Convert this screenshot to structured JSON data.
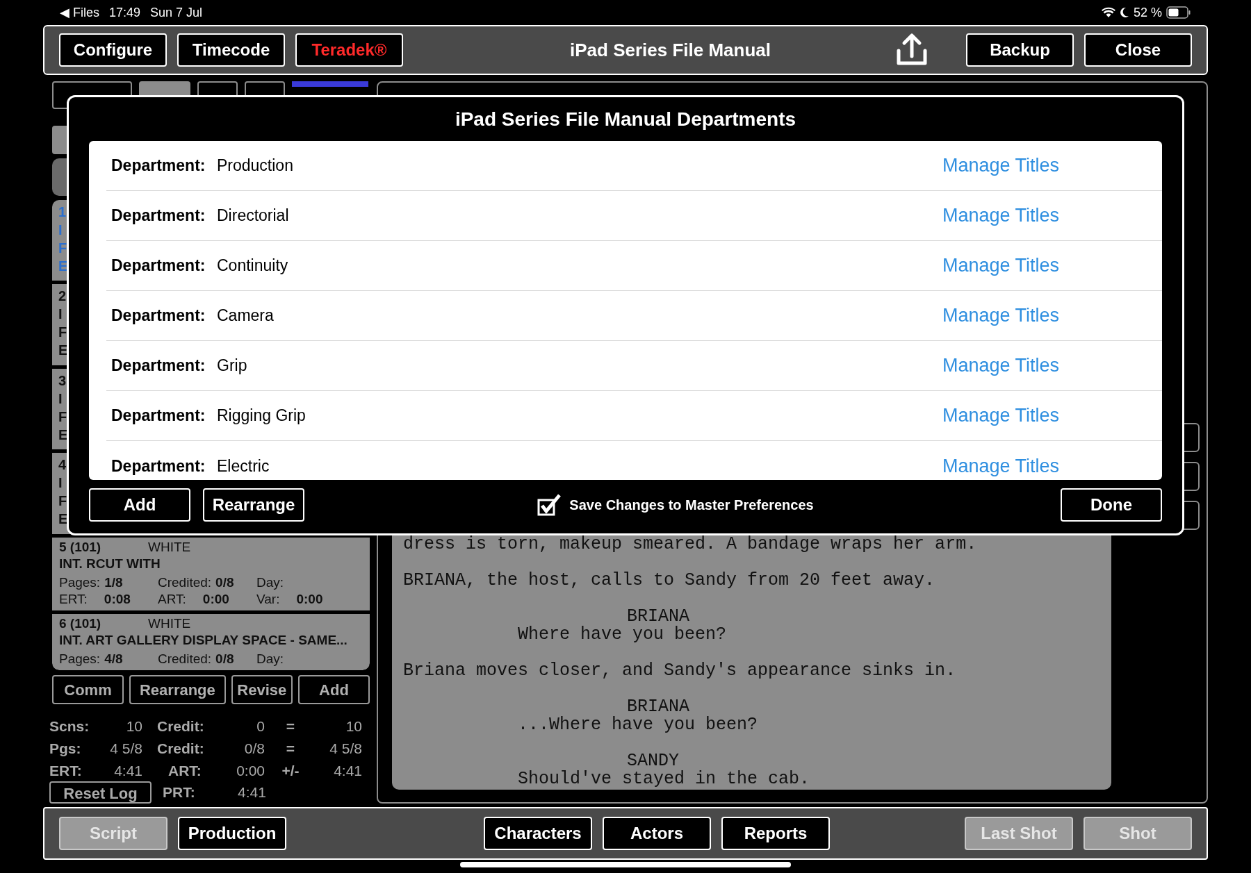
{
  "status_bar": {
    "back_label": "◀ Files",
    "time": "17:49",
    "date": "Sun 7 Jul",
    "battery": "52 %"
  },
  "toolbar": {
    "title": "iPad Series File Manual",
    "left_buttons": [
      {
        "label": "Configure",
        "kind": "normal"
      },
      {
        "label": "Timecode",
        "kind": "normal"
      },
      {
        "label": "Teradek®",
        "kind": "alert"
      }
    ],
    "right_buttons": [
      {
        "label": "Backup"
      },
      {
        "label": "Close"
      }
    ]
  },
  "left_panel": {
    "tabs": [
      {
        "selected": false
      },
      {
        "selected": true
      },
      {
        "selected": false
      },
      {
        "selected": false
      }
    ],
    "covered_scenes": [
      {
        "selected": true,
        "fragments": [
          "1",
          "I",
          "F",
          "E"
        ]
      },
      {
        "selected": false,
        "fragments": [
          "2",
          "I",
          "F",
          "E"
        ]
      },
      {
        "selected": false,
        "fragments": [
          "3",
          "I",
          "F",
          "E"
        ]
      },
      {
        "selected": false,
        "fragments": [
          "4",
          "I",
          "F",
          "E"
        ]
      }
    ],
    "scenes": [
      {
        "number": "5 (101)",
        "page_color": "WHITE",
        "heading": "INT. RCUT WITH",
        "rows": [
          [
            {
              "label": "Pages:",
              "value": "1/8"
            },
            {
              "label": "Credited:",
              "value": "0/8"
            },
            {
              "label": "Day:"
            }
          ],
          [
            {
              "label": "ERT:",
              "value": "0:08"
            },
            {
              "label": "ART:",
              "value": "0:00"
            },
            {
              "label": "Var:",
              "value": "0:00"
            }
          ]
        ]
      },
      {
        "number": "6 (101)",
        "page_color": "WHITE",
        "heading": "INT. ART GALLERY DISPLAY SPACE - SAME...",
        "rows": [
          [
            {
              "label": "Pages:",
              "value": "4/8"
            },
            {
              "label": "Credited:",
              "value": "0/8"
            },
            {
              "label": "Day:"
            }
          ]
        ]
      }
    ],
    "buttons": [
      "Comm",
      "Rearrange",
      "Revise",
      "Add"
    ],
    "stats": [
      [
        "Scns:",
        "10",
        "Credit:",
        "0",
        "=",
        "10"
      ],
      [
        "Pgs:",
        "4 5/8",
        "Credit:",
        "0/8",
        "=",
        "4 5/8"
      ],
      [
        "ERT:",
        "4:41",
        "ART:",
        "0:00",
        "+/-",
        "4:41"
      ]
    ],
    "reset_button": "Reset Log",
    "prt": {
      "label": "PRT:",
      "value": "4:41"
    }
  },
  "script": [
    {
      "kind": "action",
      "text": "dress is torn, makeup smeared. A bandage wraps her arm."
    },
    {
      "kind": "action",
      "text": "BRIANA, the host, calls to Sandy from 20 feet away."
    },
    {
      "kind": "character",
      "text": "BRIANA"
    },
    {
      "kind": "dialogue",
      "text": "Where have you been?"
    },
    {
      "kind": "action",
      "text": "Briana moves closer, and Sandy's appearance sinks in."
    },
    {
      "kind": "character",
      "text": "BRIANA"
    },
    {
      "kind": "dialogue",
      "text": "...Where have you been?"
    },
    {
      "kind": "character",
      "text": "SANDY"
    },
    {
      "kind": "dialogue",
      "text": "Should've stayed in the cab."
    }
  ],
  "dialog": {
    "title": "iPad Series File Manual Departments",
    "rows": [
      {
        "label": "Department:",
        "value": "Production",
        "link": "Manage Titles"
      },
      {
        "label": "Department:",
        "value": "Directorial",
        "link": "Manage Titles"
      },
      {
        "label": "Department:",
        "value": "Continuity",
        "link": "Manage Titles"
      },
      {
        "label": "Department:",
        "value": "Camera",
        "link": "Manage Titles"
      },
      {
        "label": "Department:",
        "value": "Grip",
        "link": "Manage Titles"
      },
      {
        "label": "Department:",
        "value": "Rigging Grip",
        "link": "Manage Titles"
      },
      {
        "label": "Department:",
        "value": "Electric",
        "link": "Manage Titles"
      }
    ],
    "add_button": "Add",
    "rearrange_button": "Rearrange",
    "save_option": {
      "label": "Save Changes to Master Preferences",
      "checked": true
    },
    "done_button": "Done"
  },
  "bottom_bar": {
    "left": [
      {
        "label": "Script",
        "disabled": true
      },
      {
        "label": "Production",
        "disabled": false
      }
    ],
    "center": [
      {
        "label": "Characters",
        "disabled": false
      },
      {
        "label": "Actors",
        "disabled": false
      },
      {
        "label": "Reports",
        "disabled": false
      }
    ],
    "right": [
      {
        "label": "Last Shot",
        "disabled": true
      },
      {
        "label": "Shot",
        "disabled": true
      }
    ]
  }
}
